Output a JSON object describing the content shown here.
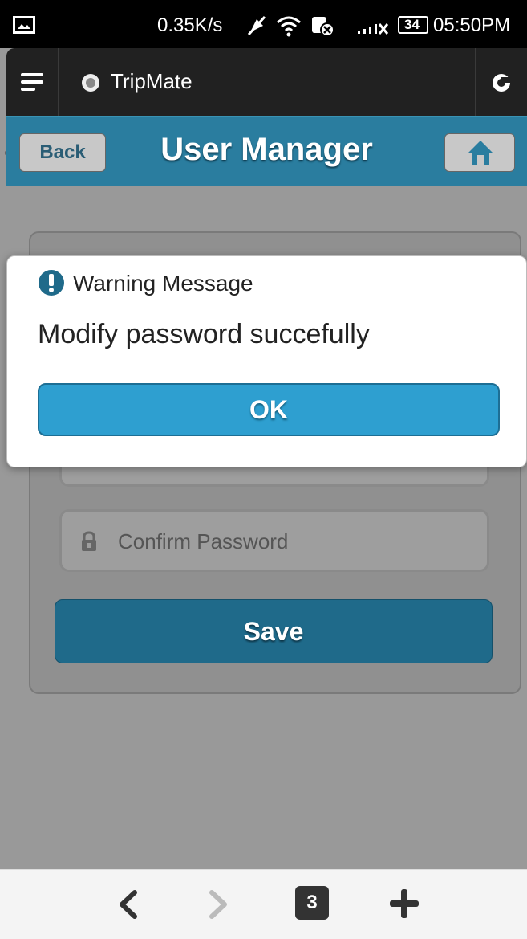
{
  "status_bar": {
    "speed": "0.35K/s",
    "battery": "34",
    "time": "05:50PM",
    "icons": [
      "image-icon",
      "mute-icon",
      "wifi-icon",
      "notification-icon",
      "signal-icon",
      "battery-icon"
    ]
  },
  "app_bar": {
    "title": "TripMate",
    "icons": [
      "menu-icon",
      "app-logo-icon",
      "refresh-icon"
    ]
  },
  "header": {
    "back_label": "Back",
    "title": "User Manager",
    "home_icon": "home-icon"
  },
  "form": {
    "confirm_password_placeholder": "Confirm Password",
    "save_label": "Save"
  },
  "dialog": {
    "title": "Warning Message",
    "message": "Modify password succefully",
    "ok_label": "OK"
  },
  "bottom_bar": {
    "tab_count": "3",
    "icons": [
      "back-arrow-icon",
      "forward-arrow-icon",
      "tabs-icon",
      "new-tab-icon"
    ]
  },
  "colors": {
    "header_bg": "#2a7d9f",
    "save_button": "#1f6a8a",
    "ok_button": "#2e9fd0",
    "overlay": "#999999"
  }
}
